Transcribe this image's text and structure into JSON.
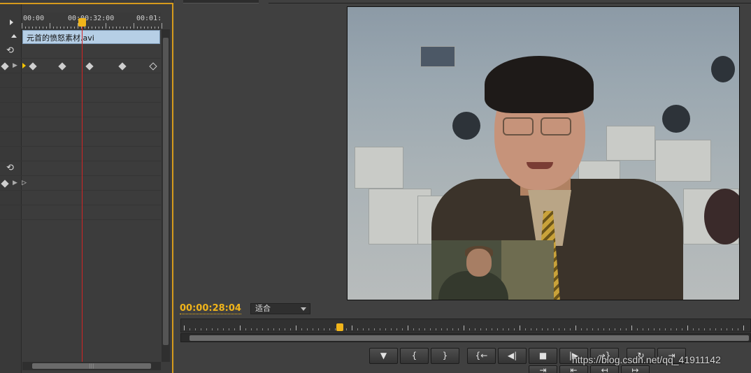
{
  "effect_controls": {
    "ruler": {
      "t0": "00:00",
      "t1": "00:00:32:00",
      "t2": "00:01:"
    },
    "clip_name": "元首的愤怒素材.avi"
  },
  "program_monitor": {
    "timecode": "00:00:28:04",
    "fit_label": "适合",
    "controls": {
      "marker": "▼",
      "mark_in": "{",
      "mark_out": "}",
      "goto_in": "{←",
      "step_back": "◀|",
      "stop": "■",
      "step_fwd": "|▶",
      "goto_out": "→}",
      "loop": "↻",
      "safe_margins": "⇥"
    }
  },
  "watermark": "https://blog.csdn.net/qq_41911142",
  "colors": {
    "accent": "#f0b41a",
    "playhead": "#d42424",
    "clip_bar": "#b6cfe6"
  }
}
